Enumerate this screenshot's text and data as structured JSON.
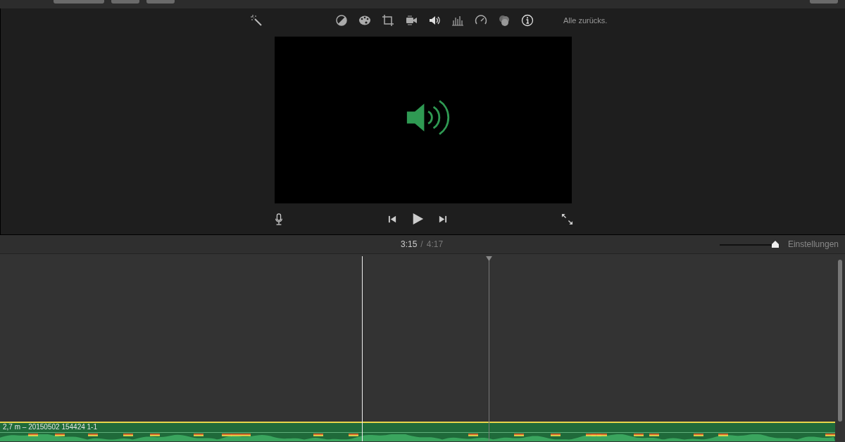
{
  "viewer": {
    "reset_label": "Alle zurücks."
  },
  "timecode": {
    "current": "3:15",
    "separator": "/",
    "total": "4:17"
  },
  "zoom": {
    "level": 0.97,
    "settings_label": "Einstellungen"
  },
  "clip": {
    "label": "2,7 m – 20150502 154424 1-1"
  }
}
